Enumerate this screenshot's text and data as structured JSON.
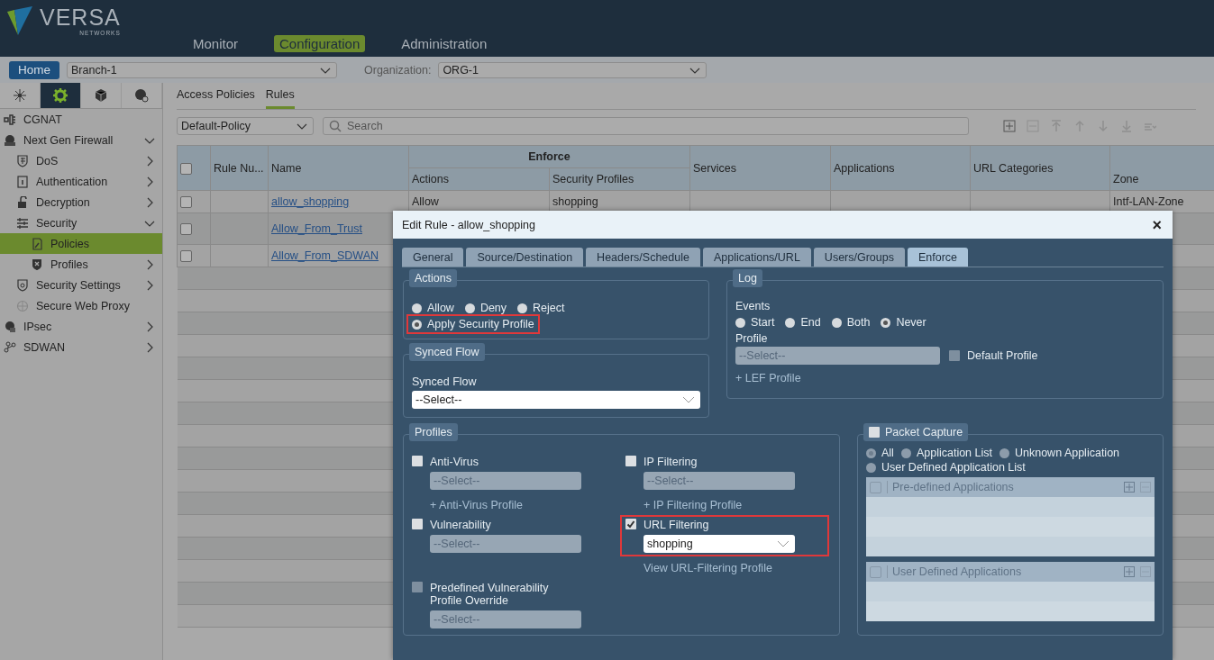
{
  "header": {
    "brand": "VERSA",
    "brand_sub": "NETWORKS",
    "nav": [
      {
        "label": "Monitor",
        "selected": false
      },
      {
        "label": "Configuration",
        "selected": true
      },
      {
        "label": "Administration",
        "selected": false
      }
    ]
  },
  "context_bar": {
    "home": "Home",
    "appliance": "Branch-1",
    "org_label": "Organization:",
    "org": "ORG-1"
  },
  "sidebar": {
    "tabs": [
      {
        "selected": false
      },
      {
        "selected": true
      },
      {
        "selected": false
      },
      {
        "selected": false
      }
    ],
    "items": [
      {
        "label": "CGNAT",
        "selected": false
      },
      {
        "label": "Next Gen Firewall",
        "selected": false,
        "expanded": true,
        "children": [
          {
            "label": "DoS",
            "selected": false,
            "expanded": false
          },
          {
            "label": "Authentication",
            "selected": false,
            "expanded": false
          },
          {
            "label": "Decryption",
            "selected": false,
            "expanded": false
          },
          {
            "label": "Security",
            "selected": false,
            "expanded": true,
            "children": [
              {
                "label": "Policies",
                "selected": true
              },
              {
                "label": "Profiles",
                "selected": false,
                "expanded": false
              }
            ]
          },
          {
            "label": "Security Settings",
            "selected": false,
            "expanded": false
          },
          {
            "label": "Secure Web Proxy",
            "selected": false
          }
        ]
      },
      {
        "label": "IPsec",
        "selected": false,
        "expanded": false
      },
      {
        "label": "SDWAN",
        "selected": false,
        "expanded": false
      }
    ]
  },
  "main": {
    "tabs": [
      {
        "label": "Access Policies",
        "selected": false
      },
      {
        "label": "Rules",
        "selected": true
      }
    ],
    "policy": "Default-Policy",
    "search": {
      "placeholder": "Search"
    },
    "toolbar": [
      {
        "kind": "add",
        "disabled": false
      },
      {
        "kind": "remove",
        "disabled": true
      },
      {
        "kind": "top",
        "disabled": true
      },
      {
        "kind": "up",
        "disabled": true
      },
      {
        "kind": "down",
        "disabled": true
      },
      {
        "kind": "bottom",
        "disabled": true
      },
      {
        "kind": "menu",
        "disabled": true
      }
    ],
    "table": {
      "select_all_checked": false,
      "group": "Enforce",
      "columns": [
        "Rule Nu...",
        "Name",
        "Actions",
        "Security Profiles",
        "Services",
        "Applications",
        "URL Categories",
        "Zone"
      ],
      "rows": [
        {
          "checked": false,
          "name": "allow_shopping",
          "action": "Allow",
          "security_profiles": "shopping",
          "zone": "Intf-LAN-Zone"
        },
        {
          "checked": false,
          "name": "Allow_From_Trust"
        },
        {
          "checked": false,
          "name": "Allow_From_SDWAN"
        }
      ]
    }
  },
  "dialog": {
    "title": "Edit Rule - allow_shopping",
    "close": "×",
    "tabs": [
      {
        "label": "General",
        "selected": false
      },
      {
        "label": "Source/Destination",
        "selected": false
      },
      {
        "label": "Headers/Schedule",
        "selected": false
      },
      {
        "label": "Applications/URL",
        "selected": false
      },
      {
        "label": "Users/Groups",
        "selected": false
      },
      {
        "label": "Enforce",
        "selected": true
      }
    ],
    "actions": {
      "legend": "Actions",
      "options": [
        {
          "label": "Allow",
          "selected": false,
          "highlighted": false
        },
        {
          "label": "Deny",
          "selected": false,
          "highlighted": false
        },
        {
          "label": "Reject",
          "selected": false,
          "highlighted": false
        },
        {
          "label": "Apply Security Profile",
          "selected": true,
          "highlighted": true
        }
      ]
    },
    "synced_flow": {
      "legend": "Synced Flow",
      "label": "Synced Flow",
      "value": "--Select--",
      "disabled": false
    },
    "log": {
      "legend": "Log",
      "events_label": "Events",
      "events": [
        {
          "label": "Start",
          "selected": false
        },
        {
          "label": "End",
          "selected": false
        },
        {
          "label": "Both",
          "selected": false
        },
        {
          "label": "Never",
          "selected": true
        }
      ],
      "profile_label": "Profile",
      "profile": "--Select--",
      "profile_disabled": true,
      "default_profile": {
        "label": "Default Profile",
        "checked": false,
        "disabled": true
      },
      "link": "+ LEF Profile"
    },
    "profiles": {
      "legend": "Profiles",
      "items": [
        {
          "label": "Anti-Virus",
          "checked": false,
          "disabled": false,
          "highlighted": false,
          "value": "--Select--",
          "link": "+ Anti-Virus Profile"
        },
        {
          "label": "IP Filtering",
          "checked": false,
          "disabled": false,
          "highlighted": false,
          "value": "--Select--",
          "link": "+ IP Filtering Profile"
        },
        {
          "label": "Vulnerability",
          "checked": false,
          "disabled": false,
          "highlighted": false,
          "value": "--Select--"
        },
        {
          "label": "URL Filtering",
          "checked": true,
          "disabled": false,
          "highlighted": true,
          "value": "shopping",
          "link": "View URL-Filtering Profile"
        },
        {
          "label": "Predefined Vulnerability Profile Override",
          "checked": false,
          "disabled": true,
          "highlighted": false,
          "value": "--Select--"
        }
      ]
    },
    "packet_capture": {
      "legend": "Packet Capture",
      "checked": false,
      "options": [
        {
          "label": "All",
          "selected": true
        },
        {
          "label": "Application List",
          "selected": false
        },
        {
          "label": "Unknown Application",
          "selected": false
        },
        {
          "label": "User Defined Application List",
          "selected": false
        }
      ],
      "lists": [
        {
          "title": "Pre-defined Applications",
          "checked": false
        },
        {
          "title": "User Defined Applications",
          "checked": false
        }
      ]
    }
  }
}
